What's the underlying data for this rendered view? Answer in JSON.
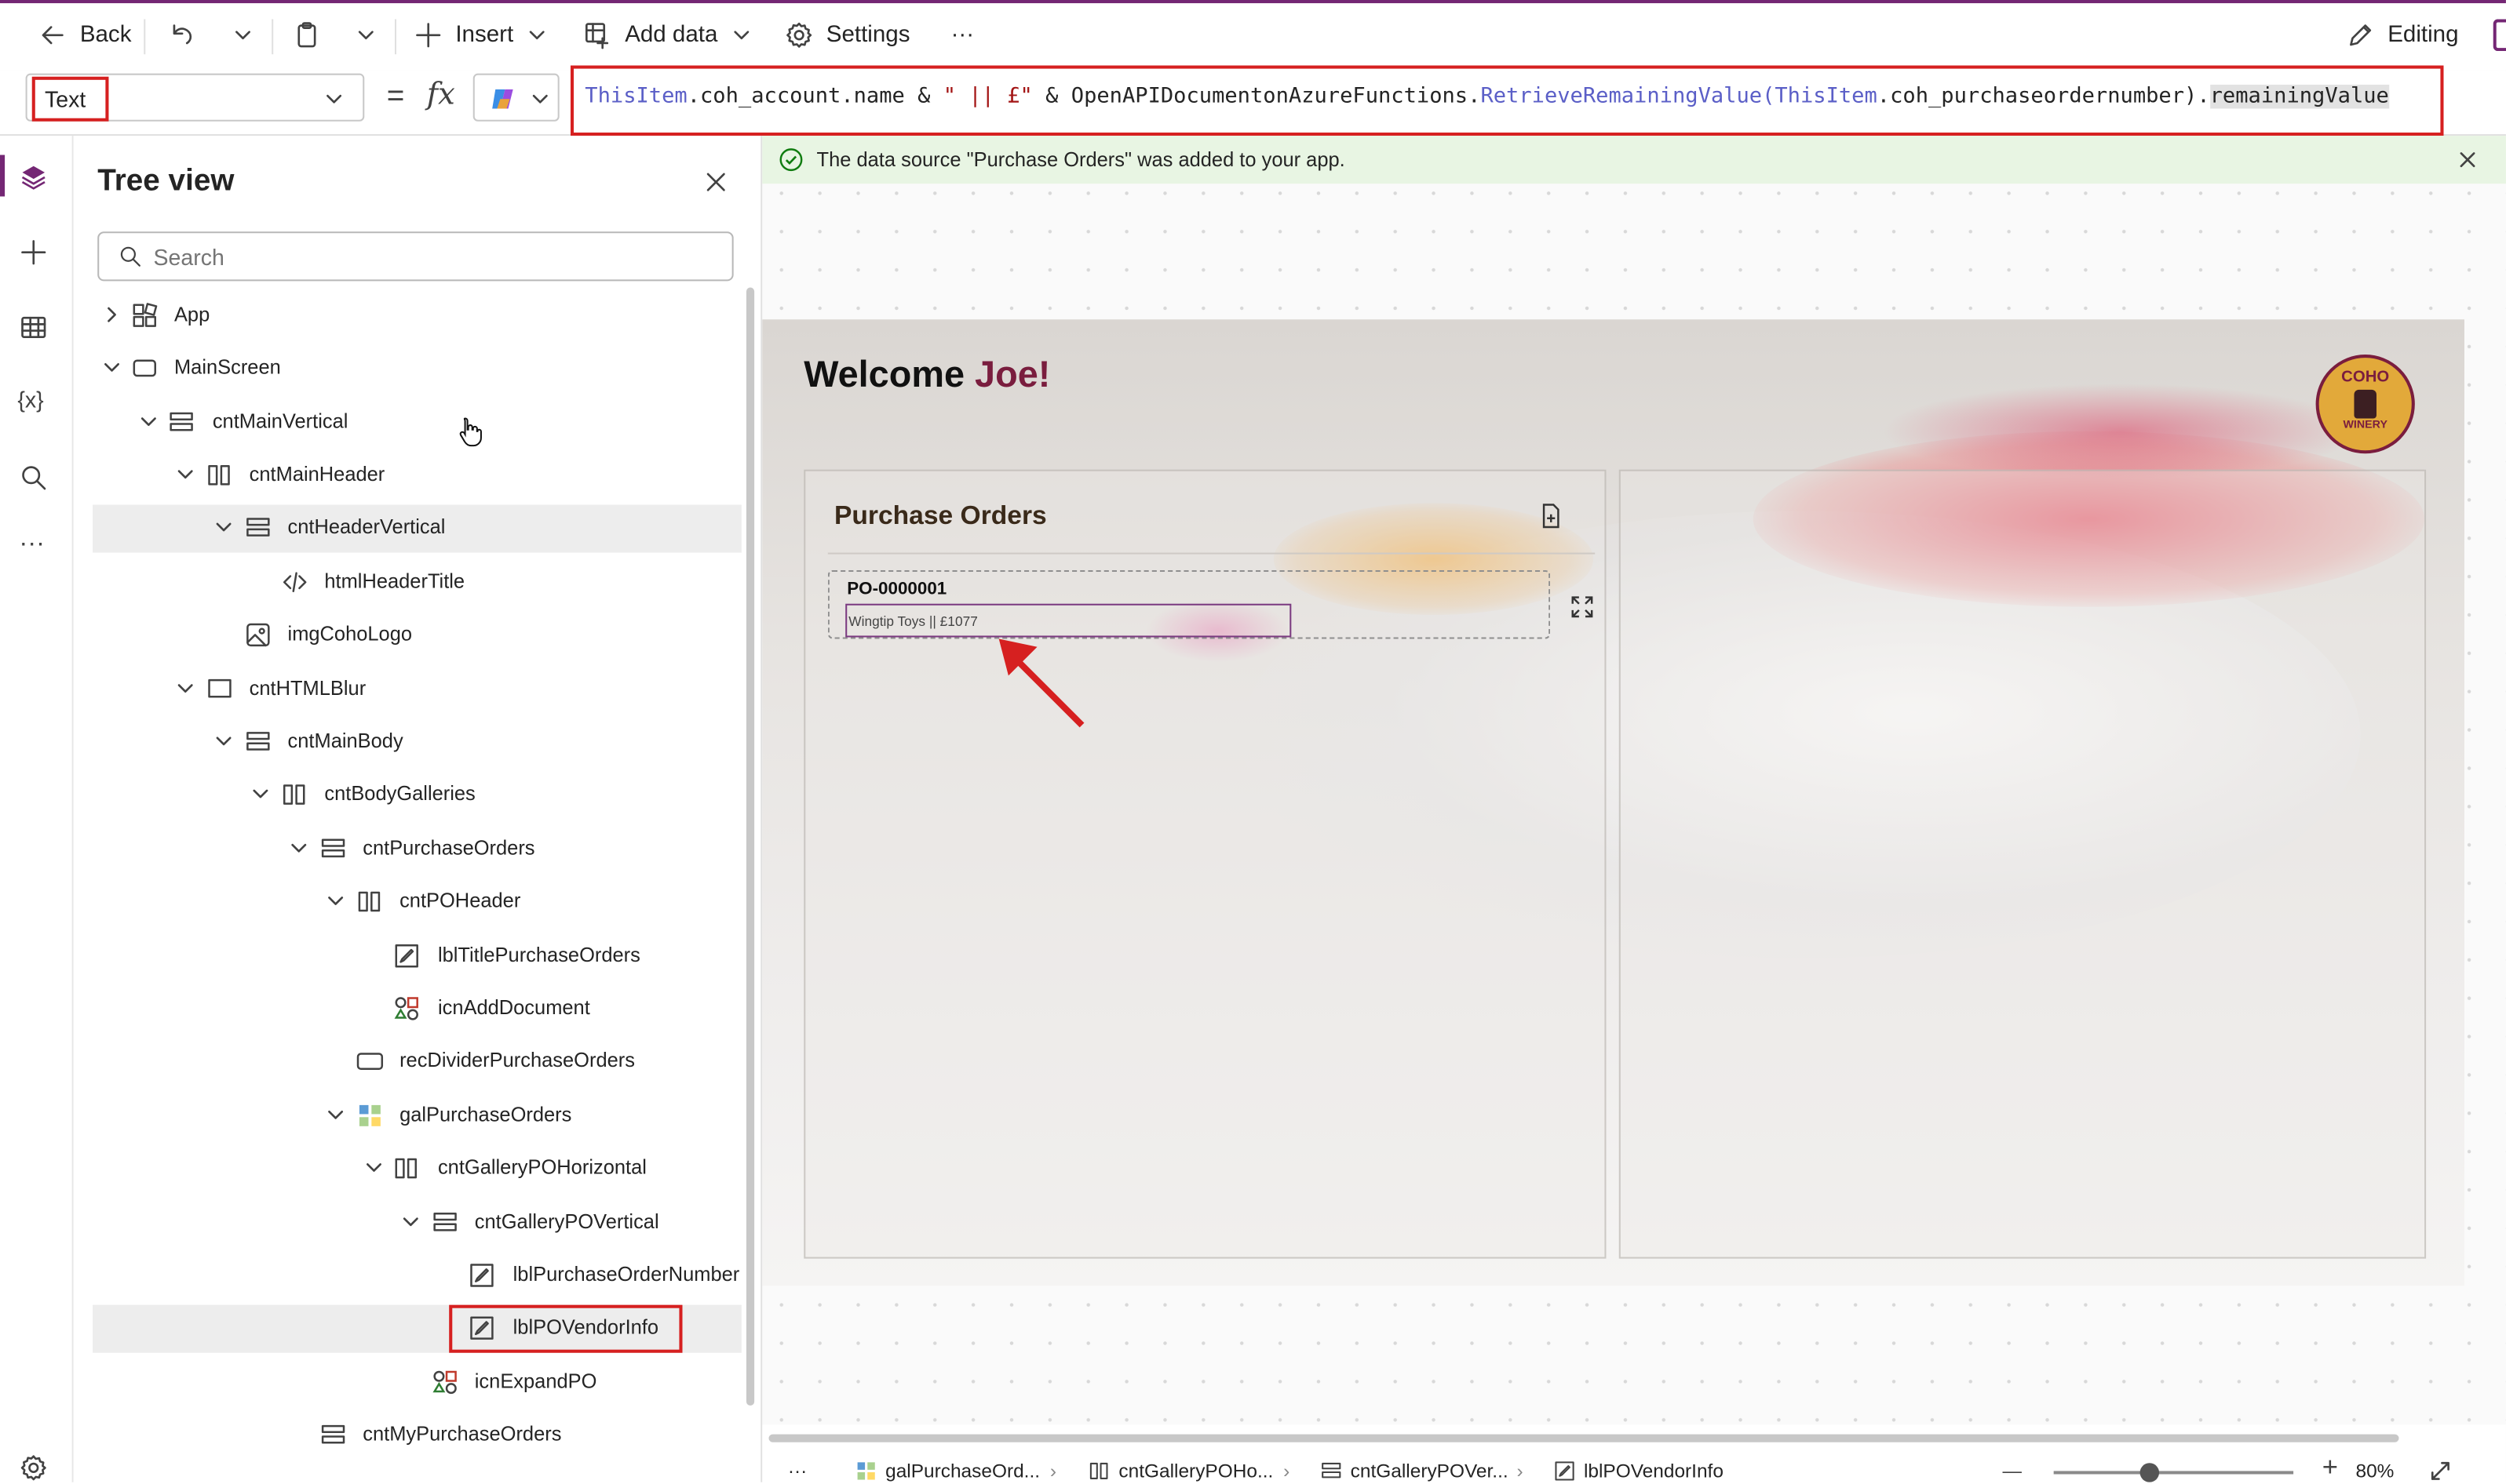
{
  "toolbar": {
    "back_label": "Back",
    "insert_label": "Insert",
    "add_data_label": "Add data",
    "settings_label": "Settings",
    "more_label": "···",
    "editing_label": "Editing"
  },
  "formula_bar": {
    "property": "Text",
    "fx_label": "fx",
    "equals": "=",
    "formula": {
      "p1": "ThisItem",
      "p2": ".coh_account.name & ",
      "p3": "\" || £\"",
      "p4": " & OpenAPIDocumentonAzureFunctions.",
      "p5": "RetrieveRemainingValue(",
      "p6": "ThisItem",
      "p7": ".coh_purchaseordernumber).",
      "p8": "remainingValue"
    }
  },
  "tree_view": {
    "title": "Tree view",
    "search_placeholder": "Search",
    "nodes": [
      {
        "label": "App"
      },
      {
        "label": "MainScreen"
      },
      {
        "label": "cntMainVertical"
      },
      {
        "label": "cntMainHeader"
      },
      {
        "label": "cntHeaderVertical"
      },
      {
        "label": "htmlHeaderTitle"
      },
      {
        "label": "imgCohoLogo"
      },
      {
        "label": "cntHTMLBlur"
      },
      {
        "label": "cntMainBody"
      },
      {
        "label": "cntBodyGalleries"
      },
      {
        "label": "cntPurchaseOrders"
      },
      {
        "label": "cntPOHeader"
      },
      {
        "label": "lblTitlePurchaseOrders"
      },
      {
        "label": "icnAddDocument"
      },
      {
        "label": "recDividerPurchaseOrders"
      },
      {
        "label": "galPurchaseOrders"
      },
      {
        "label": "cntGalleryPOHorizontal"
      },
      {
        "label": "cntGalleryPOVertical"
      },
      {
        "label": "lblPurchaseOrderNumber"
      },
      {
        "label": "lblPOVendorInfo"
      },
      {
        "label": "icnExpandPO"
      },
      {
        "label": "cntMyPurchaseOrders"
      }
    ]
  },
  "notification": {
    "message": "The data source \"Purchase Orders\" was added to your app."
  },
  "app_preview": {
    "welcome_text": "Welcome ",
    "welcome_name": "Joe!",
    "logo_top": "COHO",
    "logo_bottom": "WINERY",
    "purchase_orders_title": "Purchase Orders",
    "po_number": "PO-0000001",
    "vendor_info": "Wingtip Toys || £1077"
  },
  "bottom_bar": {
    "more": "···",
    "breadcrumbs": [
      "galPurchaseOrd...",
      "cntGalleryPOHo...",
      "cntGalleryPOVer...",
      "lblPOVendorInfo"
    ],
    "zoom_minus": "—",
    "zoom_plus": "+",
    "zoom": "80%",
    "zoom_level": 0.8
  },
  "colors": {
    "accent": "#742774",
    "highlight_red": "#d62020",
    "success_bg": "#e8f5e3",
    "success_icon": "#107c10",
    "brand_wine": "#7a1d3e"
  }
}
